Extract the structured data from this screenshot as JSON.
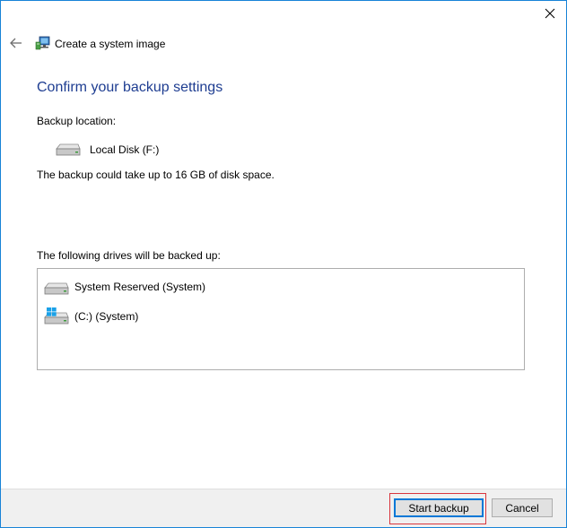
{
  "window": {
    "title": "Create a system image"
  },
  "heading": "Confirm your backup settings",
  "backup_location": {
    "label": "Backup location:",
    "drive": "Local Disk (F:)"
  },
  "space_text": "The backup could take up to 16 GB of disk space.",
  "drives": {
    "label": "The following drives will be backed up:",
    "items": [
      {
        "name": "System Reserved (System)",
        "icon": "drive-icon"
      },
      {
        "name": "(C:) (System)",
        "icon": "windows-drive-icon"
      }
    ]
  },
  "buttons": {
    "start_backup": "Start backup",
    "cancel": "Cancel"
  },
  "colors": {
    "accent": "#1e3d91",
    "window_border": "#1883d7",
    "highlight": "#d9363e"
  }
}
